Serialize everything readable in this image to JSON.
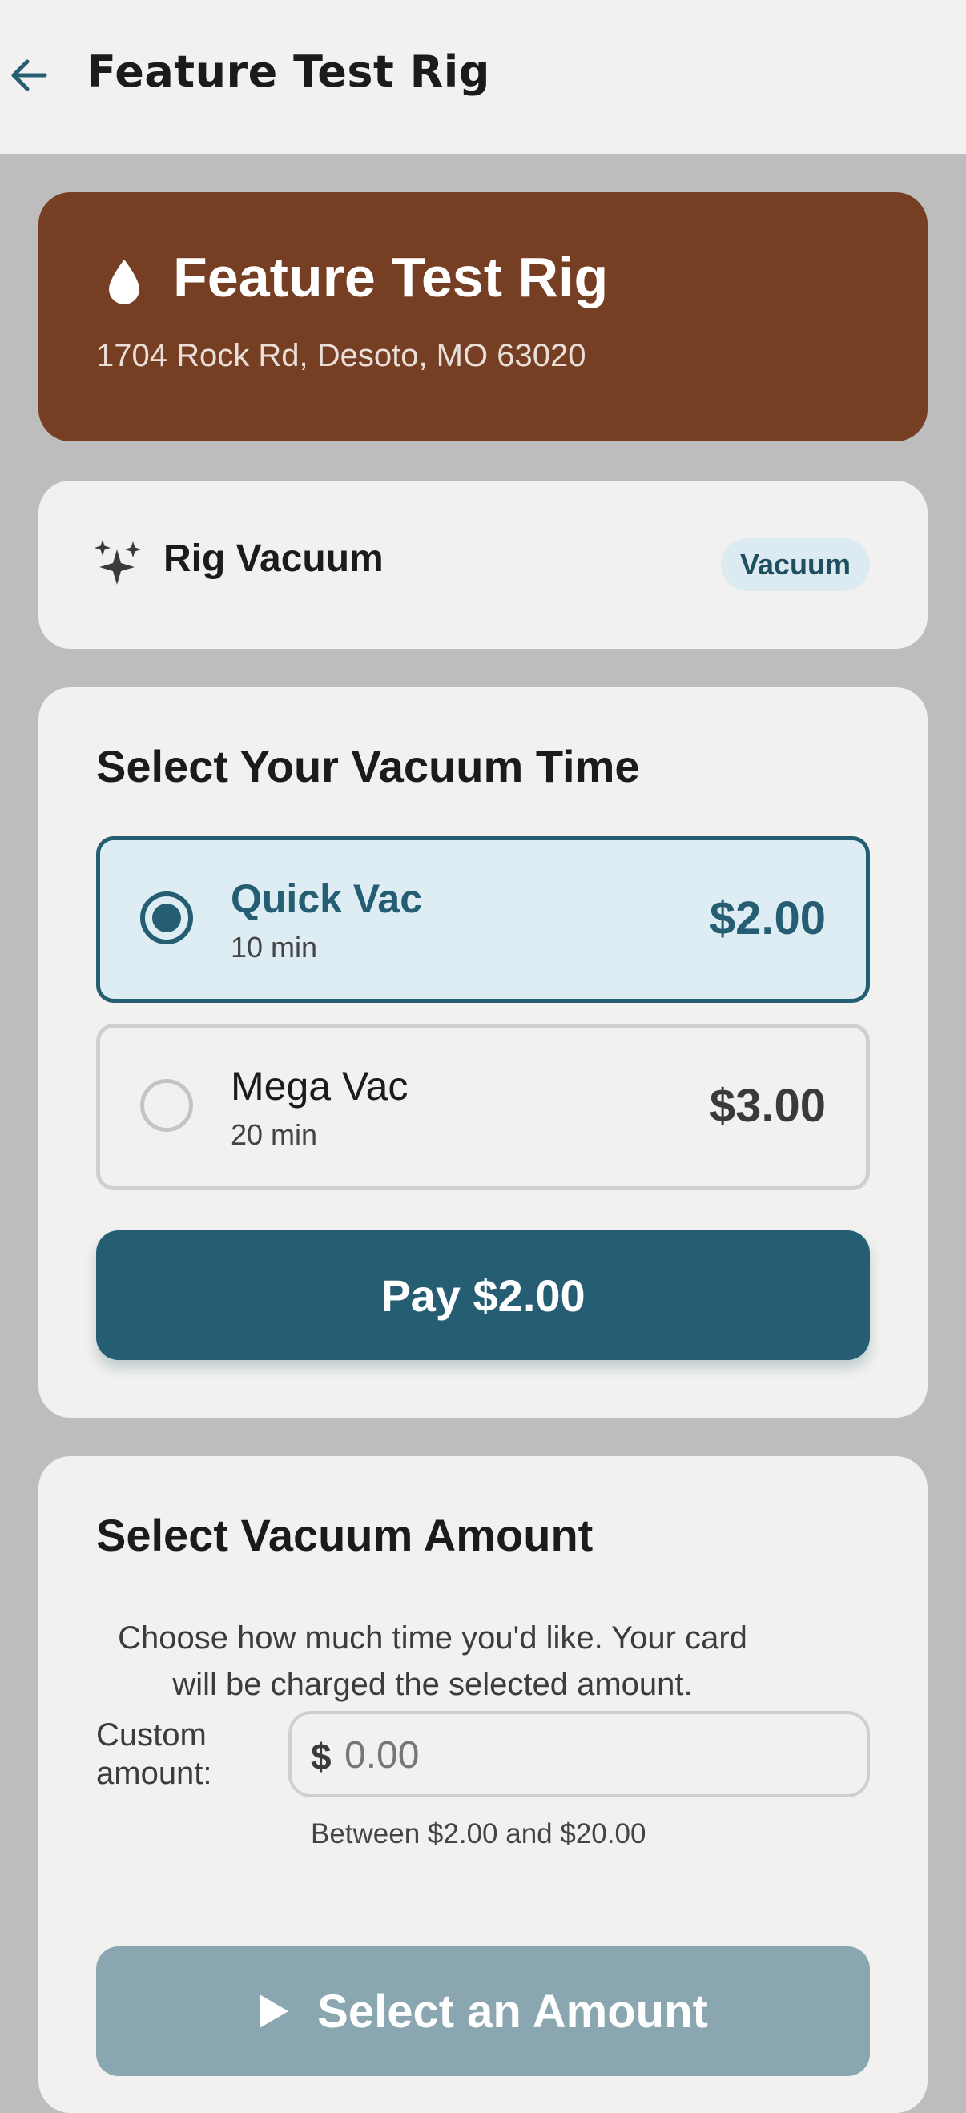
{
  "topbar": {
    "back_icon": "arrow-left-icon",
    "title": "Feature Test Rig"
  },
  "hero": {
    "icon": "water-drop-icon",
    "title": "Feature Test Rig",
    "address": "1704 Rock Rd, Desoto, MO 63020"
  },
  "service": {
    "icon": "sparkles-icon",
    "name": "Rig Vacuum",
    "badge": "Vacuum"
  },
  "time_select": {
    "title": "Select Your Vacuum Time",
    "options": [
      {
        "name": "Quick Vac",
        "duration": "10 min",
        "price": "$2.00",
        "selected": true
      },
      {
        "name": "Mega Vac",
        "duration": "20 min",
        "price": "$3.00",
        "selected": false
      }
    ],
    "pay_label": "Pay $2.00"
  },
  "amount_select": {
    "title": "Select Vacuum Amount",
    "description": "Choose how much time you'd like. Your card will be charged the selected amount.",
    "custom_label": "Custom amount:",
    "currency_symbol": "$",
    "input_value": "",
    "input_placeholder": "0.00",
    "range_hint": "Between $2.00 and $20.00",
    "button_icon": "play-icon",
    "button_label": "Select an Amount"
  },
  "colors": {
    "primary": "#255e73",
    "hero_bg": "#763f24",
    "badge_bg": "#dcebf1",
    "disabled_button": "#8aa7b1",
    "page_bg": "#bcbdbc",
    "card_bg": "#f2f1ef"
  }
}
